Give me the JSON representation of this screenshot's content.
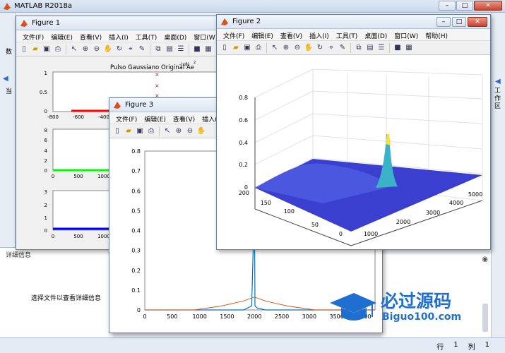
{
  "app": {
    "title": "MATLAB R2018a",
    "window_buttons": {
      "minimize": "–",
      "maximize": "□",
      "close": "✕"
    }
  },
  "left_strip": {
    "label1": "数",
    "label2": "当"
  },
  "right_strip": {
    "label": "工作区"
  },
  "detail": {
    "label": "详细信息",
    "message": "选择文件以查看详细信息"
  },
  "status": {
    "row_label": "行",
    "row_value": "1",
    "col_label": "列",
    "col_value": "1"
  },
  "watermark": {
    "cn": "必过源码",
    "en": "Biguo100.com"
  },
  "figure1": {
    "title": "Figure 1",
    "menu": [
      "文件(F)",
      "编辑(E)",
      "查看(V)",
      "插入(I)",
      "工具(T)",
      "桌面(D)",
      "窗口(W)",
      "帮"
    ],
    "subplot1": {
      "title": "Pulso Gaussiano Original Ae",
      "title_sup": "-(x8)",
      "title_exp": "2",
      "y_ticks": [
        "1",
        "0.5",
        "0"
      ],
      "x_ticks": [
        "-800",
        "-600",
        "-400"
      ]
    },
    "subplot2": {
      "y_ticks": [
        "8",
        "6",
        "4",
        "2",
        "0"
      ],
      "x_ticks": [
        "0",
        "500",
        "1000"
      ]
    },
    "subplot3": {
      "y_ticks": [
        "3",
        "2",
        "1",
        "0"
      ],
      "x_ticks": [
        "0",
        "500",
        "1000"
      ]
    },
    "colors": {
      "red": "#ff0000",
      "green": "#00ff00",
      "blue": "#0000ff"
    }
  },
  "figure2": {
    "title": "Figure 2",
    "menu": [
      "文件(F)",
      "编辑(E)",
      "查看(V)",
      "插入(I)",
      "工具(T)",
      "桌面(D)",
      "窗口(W)",
      "帮助(H)"
    ],
    "z_ticks": [
      "0.8",
      "0.6",
      "0.4",
      "0.2",
      "0"
    ],
    "y_ticks": [
      "200",
      "150",
      "100",
      "50",
      "0"
    ],
    "x_ticks": [
      "1000",
      "2000",
      "3000",
      "4000",
      "5000"
    ],
    "surface_color": "#3a3fd0"
  },
  "figure3": {
    "title": "Figure 3",
    "menu": [
      "文件(F)",
      "编辑(E)",
      "查看(V)",
      "插入(I)"
    ],
    "chart_data": {
      "type": "line",
      "x_ticks": [
        "0",
        "500",
        "1000",
        "1500",
        "2000",
        "2500",
        "3000",
        "3500",
        "4000"
      ],
      "y_ticks": [
        "0.8",
        "0.7",
        "0.6",
        "0.5",
        "0.4",
        "0.3",
        "0.2",
        "0.1",
        "0"
      ],
      "xlim": [
        0,
        4200
      ],
      "ylim": [
        0,
        0.8
      ],
      "series": [
        {
          "color": "#0072bd",
          "x": [
            0,
            1800,
            1950,
            2000,
            2010,
            2050,
            2200,
            4200
          ],
          "y": [
            0,
            0,
            0.02,
            0.55,
            0.02,
            0.01,
            0,
            0
          ]
        },
        {
          "color": "#d95319",
          "x": [
            0,
            900,
            1400,
            1800,
            2000,
            2200,
            2600,
            3100,
            4200
          ],
          "y": [
            0,
            0,
            0.02,
            0.045,
            0.065,
            0.045,
            0.02,
            0,
            0
          ]
        }
      ]
    }
  }
}
